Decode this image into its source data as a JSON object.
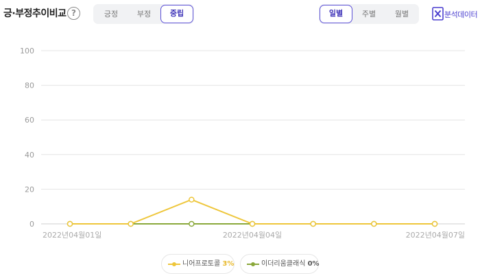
{
  "header": {
    "title": "긍·부정추이비교",
    "help_glyph": "?",
    "sentiment_tabs": [
      {
        "label": "긍정",
        "active": false
      },
      {
        "label": "부정",
        "active": false
      },
      {
        "label": "중립",
        "active": true
      }
    ],
    "period_tabs": [
      {
        "label": "일별",
        "active": true
      },
      {
        "label": "주별",
        "active": false
      },
      {
        "label": "월별",
        "active": false
      }
    ],
    "export_label": "분석데이터",
    "export_icon": "excel-icon",
    "accent_color": "#5b50d6"
  },
  "chart_data": {
    "type": "line",
    "x": [
      "2022년04월01일",
      "2022년04월02일",
      "2022년04월03일",
      "2022년04월04일",
      "2022년04월05일",
      "2022년04월06일",
      "2022년04월07일"
    ],
    "x_tick_labels": [
      "2022년04월01일",
      "",
      "",
      "2022년04월04일",
      "",
      "",
      "2022년04월07일"
    ],
    "ylim": [
      0,
      100
    ],
    "yticks": [
      0,
      20,
      40,
      60,
      80,
      100
    ],
    "grid": true,
    "legend_position": "bottom",
    "series": [
      {
        "name": "니어프로토콜",
        "share": "3%",
        "color": "#eec63a",
        "values": [
          0,
          0,
          14,
          0,
          0,
          0,
          0
        ]
      },
      {
        "name": "이더리움클래식",
        "share": "0%",
        "color": "#8aa83a",
        "values": [
          0,
          0,
          0,
          0,
          0,
          0,
          0
        ]
      }
    ]
  }
}
